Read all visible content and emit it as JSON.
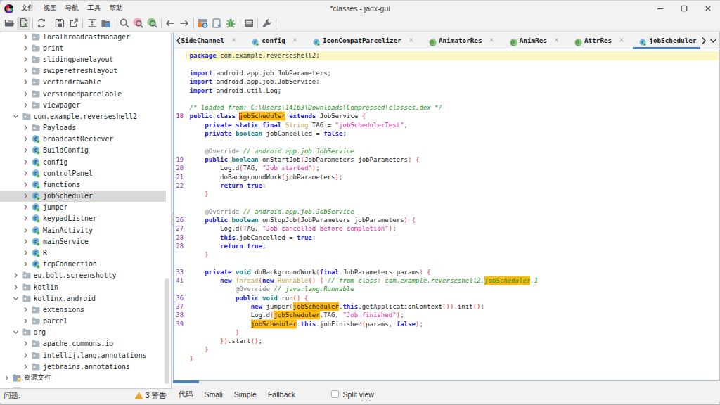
{
  "window": {
    "title": "*classes - jadx-gui"
  },
  "menubar": {
    "items": [
      "文件",
      "视图",
      "导航",
      "工具",
      "帮助"
    ]
  },
  "window_controls": {
    "minimize": "minimize",
    "maximize": "maximize",
    "close": "close"
  },
  "toolbar": {
    "groups": [
      [
        "open-file",
        "add-files"
      ],
      [
        "reload"
      ],
      [
        "save-all",
        "export"
      ],
      [
        "sync",
        "flat-packages"
      ],
      [
        "search-text",
        "search-usage",
        "search-comment"
      ],
      [
        "nav-back",
        "nav-forward"
      ],
      [
        "deobfuscation",
        "quark-analysis",
        "debugger"
      ],
      [
        "log-viewer"
      ],
      [
        "preferences"
      ]
    ],
    "hovered": "add-files"
  },
  "tree": {
    "items": [
      {
        "label": "localbroadcastmanager",
        "level": 2,
        "icon": "folder",
        "expanded": false
      },
      {
        "label": "print",
        "level": 2,
        "icon": "folder",
        "expanded": false
      },
      {
        "label": "slidingpanelayout",
        "level": 2,
        "icon": "folder",
        "expanded": false
      },
      {
        "label": "swiperefreshlayout",
        "level": 2,
        "icon": "folder",
        "expanded": false
      },
      {
        "label": "vectordrawable",
        "level": 2,
        "icon": "folder",
        "expanded": false
      },
      {
        "label": "versionedparcelable",
        "level": 2,
        "icon": "folder",
        "expanded": false
      },
      {
        "label": "viewpager",
        "level": 2,
        "icon": "folder",
        "expanded": false
      },
      {
        "label": "com.example.reverseshell2",
        "level": 1,
        "icon": "folder",
        "expanded": true
      },
      {
        "label": "Payloads",
        "level": 2,
        "icon": "folder",
        "expanded": false
      },
      {
        "label": "broadcastReciever",
        "level": 2,
        "icon": "class",
        "expanded": false
      },
      {
        "label": "BuildConfig",
        "level": 2,
        "icon": "class",
        "expanded": false
      },
      {
        "label": "config",
        "level": 2,
        "icon": "class",
        "expanded": false
      },
      {
        "label": "controlPanel",
        "level": 2,
        "icon": "class",
        "expanded": false
      },
      {
        "label": "functions",
        "level": 2,
        "icon": "class",
        "expanded": false
      },
      {
        "label": "jobScheduler",
        "level": 2,
        "icon": "class",
        "expanded": false,
        "selected": true
      },
      {
        "label": "jumper",
        "level": 2,
        "icon": "class",
        "expanded": false
      },
      {
        "label": "keypadListner",
        "level": 2,
        "icon": "class",
        "expanded": false
      },
      {
        "label": "MainActivity",
        "level": 2,
        "icon": "class",
        "expanded": false
      },
      {
        "label": "mainService",
        "level": 2,
        "icon": "class",
        "expanded": false
      },
      {
        "label": "R",
        "level": 2,
        "icon": "class",
        "expanded": false
      },
      {
        "label": "tcpConnection",
        "level": 2,
        "icon": "class",
        "expanded": false
      },
      {
        "label": "eu.bolt.screenshotty",
        "level": 1,
        "icon": "folder",
        "expanded": false
      },
      {
        "label": "kotlin",
        "level": 1,
        "icon": "folder",
        "expanded": false
      },
      {
        "label": "kotlinx.android",
        "level": 1,
        "icon": "folder",
        "expanded": true
      },
      {
        "label": "extensions",
        "level": 2,
        "icon": "folder",
        "expanded": false
      },
      {
        "label": "parcel",
        "level": 2,
        "icon": "folder",
        "expanded": false
      },
      {
        "label": "org",
        "level": 1,
        "icon": "folder",
        "expanded": true
      },
      {
        "label": "apache.commons.io",
        "level": 2,
        "icon": "folder",
        "expanded": false
      },
      {
        "label": "intellij.lang.annotations",
        "level": 2,
        "icon": "folder",
        "expanded": false
      },
      {
        "label": "jetbrains.annotations",
        "level": 2,
        "icon": "folder",
        "expanded": false
      },
      {
        "label": "资源文件",
        "level": 0,
        "icon": "resfolder",
        "expanded": false
      },
      {
        "label": "",
        "level": 0,
        "icon": "partial",
        "expanded": null
      }
    ]
  },
  "editor_tabs": {
    "tabs": [
      {
        "label": "SideChannel",
        "icon": "none",
        "close": true,
        "active": false
      },
      {
        "label": "config",
        "icon": "class",
        "close": true,
        "active": false
      },
      {
        "label": "IconCompatParcelizer",
        "icon": "class",
        "close": true,
        "active": false
      },
      {
        "label": "AnimatorRes",
        "icon": "annotation",
        "close": true,
        "active": false
      },
      {
        "label": "AnimRes",
        "icon": "annotation",
        "close": true,
        "active": false
      },
      {
        "label": "AttrRes",
        "icon": "annotation",
        "close": true,
        "active": false
      },
      {
        "label": "jobScheduler",
        "icon": "class",
        "close": false,
        "active": true
      }
    ],
    "close_glyph": "✕"
  },
  "code": {
    "lines": [
      {
        "caret_line": true,
        "s": [
          [
            "kw",
            "package"
          ],
          [
            "pl",
            " com.example.reverseshell2;"
          ]
        ]
      },
      {
        "s": []
      },
      {
        "s": [
          [
            "kw",
            "import"
          ],
          [
            "pl",
            " android.app.job.JobParameters;"
          ]
        ]
      },
      {
        "s": [
          [
            "kw",
            "import"
          ],
          [
            "pl",
            " android.app.job.JobService;"
          ]
        ]
      },
      {
        "s": [
          [
            "kw",
            "import"
          ],
          [
            "pl",
            " android.util.Log;"
          ]
        ]
      },
      {
        "s": []
      },
      {
        "s": [
          [
            "cm",
            "/* loaded from: C:\\Users\\14163\\Downloads\\Compressed\\classes.dex */"
          ]
        ]
      },
      {
        "n": "18",
        "cur": true,
        "s": [
          [
            "kw",
            "public"
          ],
          [
            "pl",
            " "
          ],
          [
            "kw",
            "class"
          ],
          [
            "pl",
            " "
          ],
          [
            "hlx",
            "jobScheduler"
          ],
          [
            "pl",
            " "
          ],
          [
            "kw",
            "extends"
          ],
          [
            "pl",
            " JobService "
          ],
          [
            "sep",
            "{"
          ]
        ]
      },
      {
        "s": [
          [
            "pl",
            "    "
          ],
          [
            "kw",
            "private"
          ],
          [
            "pl",
            " "
          ],
          [
            "kw",
            "static"
          ],
          [
            "pl",
            " "
          ],
          [
            "kw",
            "final"
          ],
          [
            "pl",
            " "
          ],
          [
            "fn",
            "String"
          ],
          [
            "pl",
            " TAG = "
          ],
          [
            "str",
            "\"jobSchedulerTest\""
          ],
          [
            "pl",
            ";"
          ]
        ]
      },
      {
        "s": [
          [
            "pl",
            "    "
          ],
          [
            "kw",
            "private"
          ],
          [
            "pl",
            " "
          ],
          [
            "ty",
            "boolean"
          ],
          [
            "pl",
            " jobCancelled = "
          ],
          [
            "kw",
            "false"
          ],
          [
            "pl",
            ";"
          ]
        ]
      },
      {
        "s": []
      },
      {
        "s": [
          [
            "pl",
            "    "
          ],
          [
            "an",
            "@Override"
          ],
          [
            "pl",
            " "
          ],
          [
            "cm",
            "// android.app.job.JobService"
          ]
        ]
      },
      {
        "n": "19",
        "s": [
          [
            "pl",
            "    "
          ],
          [
            "kw",
            "public"
          ],
          [
            "pl",
            " "
          ],
          [
            "ty",
            "boolean"
          ],
          [
            "pl",
            " onStartJob"
          ],
          [
            "sep",
            "("
          ],
          [
            "pl",
            "JobParameters jobParameters"
          ],
          [
            "sep",
            ") {"
          ]
        ]
      },
      {
        "n": "20",
        "s": [
          [
            "pl",
            "        Log.d"
          ],
          [
            "sep",
            "("
          ],
          [
            "pl",
            "TAG, "
          ],
          [
            "str",
            "\"Job started\""
          ],
          [
            "sep",
            ")"
          ],
          [
            "pl",
            ";"
          ]
        ]
      },
      {
        "n": "21",
        "s": [
          [
            "pl",
            "        doBackgroundWork"
          ],
          [
            "sep",
            "("
          ],
          [
            "pl",
            "jobParameters"
          ],
          [
            "sep",
            ")"
          ],
          [
            "pl",
            ";"
          ]
        ]
      },
      {
        "n": "22",
        "s": [
          [
            "pl",
            "        "
          ],
          [
            "kw",
            "return"
          ],
          [
            "pl",
            " "
          ],
          [
            "kw",
            "true"
          ],
          [
            "pl",
            ";"
          ]
        ]
      },
      {
        "s": [
          [
            "pl",
            "    "
          ],
          [
            "sep",
            "}"
          ]
        ]
      },
      {
        "s": []
      },
      {
        "s": [
          [
            "pl",
            "    "
          ],
          [
            "an",
            "@Override"
          ],
          [
            "pl",
            " "
          ],
          [
            "cm",
            "// android.app.job.JobService"
          ]
        ]
      },
      {
        "n": "26",
        "s": [
          [
            "pl",
            "    "
          ],
          [
            "kw",
            "public"
          ],
          [
            "pl",
            " "
          ],
          [
            "ty",
            "boolean"
          ],
          [
            "pl",
            " onStopJob"
          ],
          [
            "sep",
            "("
          ],
          [
            "pl",
            "JobParameters jobParameters"
          ],
          [
            "sep",
            ") {"
          ]
        ]
      },
      {
        "n": "27",
        "s": [
          [
            "pl",
            "        Log.d"
          ],
          [
            "sep",
            "("
          ],
          [
            "pl",
            "TAG, "
          ],
          [
            "str",
            "\"Job cancelled before completion\""
          ],
          [
            "sep",
            ")"
          ],
          [
            "pl",
            ";"
          ]
        ]
      },
      {
        "n": "28",
        "s": [
          [
            "pl",
            "        "
          ],
          [
            "kw",
            "this"
          ],
          [
            "pl",
            ".jobCancelled = "
          ],
          [
            "kw",
            "true"
          ],
          [
            "pl",
            ";"
          ]
        ]
      },
      {
        "n": "28",
        "s": [
          [
            "pl",
            "        "
          ],
          [
            "kw",
            "return"
          ],
          [
            "pl",
            " "
          ],
          [
            "kw",
            "true"
          ],
          [
            "pl",
            ";"
          ]
        ]
      },
      {
        "s": [
          [
            "pl",
            "    "
          ],
          [
            "sep",
            "}"
          ]
        ]
      },
      {
        "s": []
      },
      {
        "n": "33",
        "s": [
          [
            "pl",
            "    "
          ],
          [
            "kw",
            "private"
          ],
          [
            "pl",
            " "
          ],
          [
            "ty",
            "void"
          ],
          [
            "pl",
            " doBackgroundWork"
          ],
          [
            "sep",
            "("
          ],
          [
            "kw",
            "final"
          ],
          [
            "pl",
            " JobParameters params"
          ],
          [
            "sep",
            ") {"
          ]
        ]
      },
      {
        "n": "41",
        "s": [
          [
            "pl",
            "        "
          ],
          [
            "kw",
            "new"
          ],
          [
            "pl",
            " "
          ],
          [
            "fn",
            "Thread"
          ],
          [
            "sep",
            "("
          ],
          [
            "kw",
            "new"
          ],
          [
            "pl",
            " "
          ],
          [
            "fn",
            "Runnable"
          ],
          [
            "sep",
            "()"
          ],
          [
            "pl",
            " "
          ],
          [
            "sep",
            "{"
          ],
          [
            "pl",
            " "
          ],
          [
            "cm",
            "// from class: com.example.reverseshell2."
          ],
          [
            "hlc",
            "jobScheduler"
          ],
          [
            "cm",
            ".1"
          ]
        ]
      },
      {
        "s": [
          [
            "pl",
            "            "
          ],
          [
            "an",
            "@Override"
          ],
          [
            "pl",
            " "
          ],
          [
            "cm",
            "// java.lang.Runnable"
          ]
        ]
      },
      {
        "n": "36",
        "s": [
          [
            "pl",
            "            "
          ],
          [
            "kw",
            "public"
          ],
          [
            "pl",
            " "
          ],
          [
            "ty",
            "void"
          ],
          [
            "pl",
            " run"
          ],
          [
            "sep",
            "()"
          ],
          [
            "pl",
            " "
          ],
          [
            "sep",
            "{"
          ]
        ]
      },
      {
        "n": "37",
        "s": [
          [
            "pl",
            "                "
          ],
          [
            "kw",
            "new"
          ],
          [
            "pl",
            " jumper"
          ],
          [
            "sep",
            "("
          ],
          [
            "hl",
            "jobScheduler"
          ],
          [
            "pl",
            "."
          ],
          [
            "kw",
            "this"
          ],
          [
            "pl",
            ".getApplicationContext"
          ],
          [
            "sep",
            "())"
          ],
          [
            "pl",
            ".init"
          ],
          [
            "sep",
            "()"
          ],
          [
            "pl",
            ";"
          ]
        ]
      },
      {
        "n": "38",
        "s": [
          [
            "pl",
            "                Log.d"
          ],
          [
            "sep",
            "("
          ],
          [
            "hl",
            "jobScheduler"
          ],
          [
            "pl",
            ".TAG, "
          ],
          [
            "str",
            "\"Job finished\""
          ],
          [
            "sep",
            ")"
          ],
          [
            "pl",
            ";"
          ]
        ]
      },
      {
        "n": "39",
        "s": [
          [
            "pl",
            "                "
          ],
          [
            "hl",
            "jobScheduler"
          ],
          [
            "pl",
            "."
          ],
          [
            "kw",
            "this"
          ],
          [
            "pl",
            ".jobFinished"
          ],
          [
            "sep",
            "("
          ],
          [
            "pl",
            "params, "
          ],
          [
            "kw",
            "false"
          ],
          [
            "sep",
            ")"
          ],
          [
            "pl",
            ";"
          ]
        ]
      },
      {
        "s": [
          [
            "pl",
            "            "
          ],
          [
            "sep",
            "}"
          ]
        ]
      },
      {
        "s": [
          [
            "pl",
            "        "
          ],
          [
            "sep",
            "})"
          ],
          [
            "pl",
            ".start"
          ],
          [
            "sep",
            "()"
          ],
          [
            "pl",
            ";"
          ]
        ]
      },
      {
        "s": [
          [
            "pl",
            "    "
          ],
          [
            "sep",
            "}"
          ]
        ]
      },
      {
        "s": [
          [
            "sep",
            "}"
          ]
        ]
      }
    ]
  },
  "status": {
    "problems_label": "问题:",
    "warning_count": "3 警告",
    "bottom_tabs": [
      "代码",
      "Smali",
      "Simple",
      "Fallback"
    ],
    "active_bottom_tab": "代码",
    "split_view_label": "Split view"
  },
  "colors": {
    "accent_underline": "#4a7fc1",
    "occurrence_highlight": "#ffba0e",
    "caret_line": "#fbf8c6",
    "selection_gray": "#d9d9d9",
    "warning_orange": "#f0a30a"
  }
}
